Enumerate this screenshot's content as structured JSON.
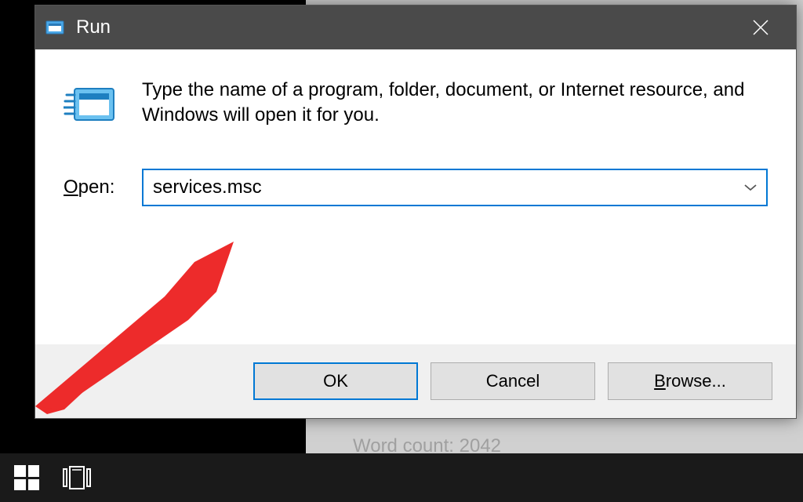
{
  "titlebar": {
    "title": "Run"
  },
  "body": {
    "instruction": "Type the name of a program, folder, document, or Internet resource, and Windows will open it for you.",
    "open_label_pre": "O",
    "open_label_rest": "pen:",
    "input_value": "services.msc"
  },
  "buttons": {
    "ok": "OK",
    "cancel": "Cancel",
    "browse_pre": "B",
    "browse_rest": "rowse..."
  },
  "background": {
    "partial": "Word count: 2042"
  }
}
